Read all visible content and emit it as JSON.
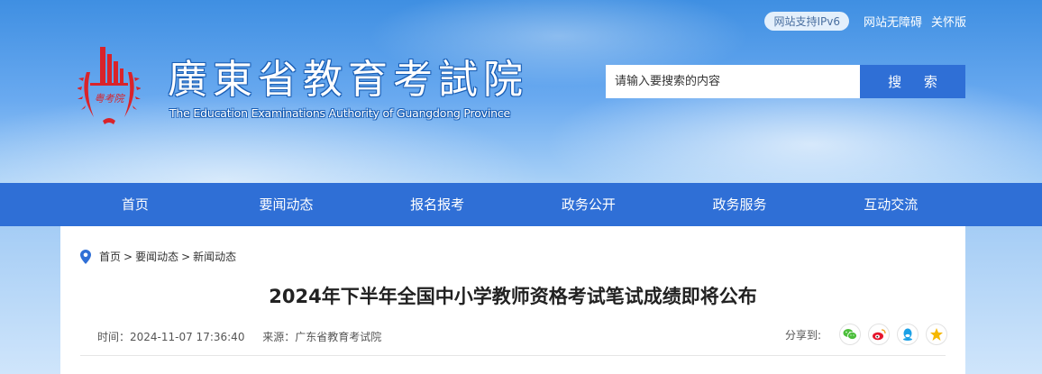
{
  "header": {
    "ipv6_badge": "网站支持IPv6",
    "accessibility_link": "网站无障碍",
    "elder_mode_link": "关怀版",
    "site_title": "廣東省教育考試院",
    "site_subtitle": "The Education Examinations Authority of Guangdong Province",
    "logo_text": "粤考院",
    "search": {
      "placeholder": "请输入要搜索的内容",
      "button_label": "搜 索"
    }
  },
  "nav": {
    "items": [
      {
        "label": "首页"
      },
      {
        "label": "要闻动态"
      },
      {
        "label": "报名报考"
      },
      {
        "label": "政务公开"
      },
      {
        "label": "政务服务"
      },
      {
        "label": "互动交流"
      }
    ]
  },
  "breadcrumb": {
    "items": [
      "首页",
      "要闻动态",
      "新闻动态"
    ],
    "separator": ">"
  },
  "article": {
    "title": "2024年下半年全国中小学教师资格考试笔试成绩即将公布",
    "time": "时间：2024-11-07 17:36:40",
    "source": "来源：广东省教育考试院",
    "share_label": "分享到:"
  },
  "share_icons": [
    "wechat-icon",
    "weibo-icon",
    "qq-icon",
    "qzone-icon"
  ],
  "colors": {
    "nav_blue": "#2f6fd6",
    "logo_red": "#d9232a"
  }
}
